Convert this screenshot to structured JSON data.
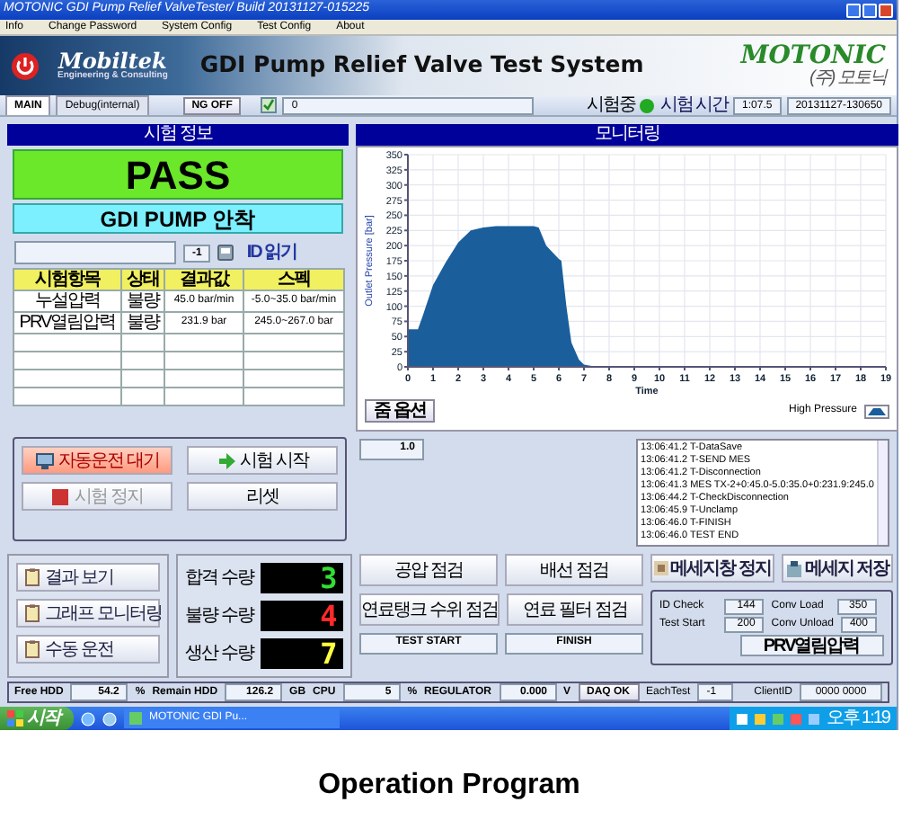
{
  "window": {
    "title": "MOTONIC GDI Pump Relief ValveTester/ Build 20131127-015225"
  },
  "menu": [
    "Info",
    "Change Password",
    "System Config",
    "Test Config",
    "About"
  ],
  "header": {
    "logo": "Mobiltek",
    "logo_subtitle": "Engineering & Consulting",
    "title": "GDI Pump Relief Valve Test System",
    "brand": "MOTONIC",
    "brand_subtitle": "(주) 모토닉"
  },
  "toolbar": {
    "tabs": [
      {
        "label": "MAIN",
        "selected": true
      },
      {
        "label": "Debug(internal)",
        "selected": false
      }
    ],
    "ng_button": "NG OFF",
    "checked": true,
    "counter": "0",
    "testing_label": "시험중",
    "testing_on": true,
    "time_label": "시험 시간",
    "time": "1:07.5",
    "timestamp": "20131127-130650"
  },
  "info_panel": {
    "heading": "시험 정보",
    "result": "PASS",
    "product": "GDI PUMP 안착",
    "id_count": "-1",
    "id_button": "ID 읽기",
    "table": {
      "columns": [
        "시험항목",
        "상태",
        "결과값",
        "스펙"
      ],
      "rows": [
        [
          "누설압력",
          "불량",
          "45.0 bar/min",
          "-5.0~35.0 bar/min"
        ],
        [
          "PRV열림압력",
          "불량",
          "231.9 bar",
          "245.0~267.0 bar"
        ]
      ]
    }
  },
  "monitor": {
    "heading": "모니터링",
    "zoom_button": "줌 옵션",
    "chart_data": {
      "type": "area",
      "xlabel": "Time",
      "ylabel": "Outlet Pressure [bar]",
      "x": [
        0,
        0.4,
        0.6,
        1,
        1.5,
        2,
        2.5,
        3,
        3.5,
        4,
        5,
        5.2,
        5.5,
        6,
        6.1,
        6.3,
        6.5,
        6.8,
        7,
        7.5,
        19
      ],
      "series": [
        {
          "name": "High Pressure",
          "color": "#1a5e9c",
          "values": [
            62,
            62,
            85,
            135,
            172,
            205,
            225,
            230,
            232,
            232,
            232,
            230,
            200,
            178,
            175,
            100,
            40,
            12,
            4,
            0,
            0
          ]
        }
      ],
      "xlim": [
        0,
        19
      ],
      "ylim": [
        0,
        350
      ],
      "grid": true,
      "xticks": [
        0,
        1,
        2,
        3,
        4,
        5,
        6,
        7,
        8,
        9,
        10,
        11,
        12,
        13,
        14,
        15,
        16,
        17,
        18,
        19
      ],
      "yticks": [
        0,
        25,
        50,
        75,
        100,
        125,
        150,
        175,
        200,
        225,
        250,
        275,
        300,
        325,
        350
      ]
    }
  },
  "scale_value": "1.0",
  "control_buttons": [
    {
      "kind": "auto",
      "label": "자동운전 대기",
      "active": true,
      "disabled": false
    },
    {
      "kind": "start",
      "label": "시험 시작",
      "active": false,
      "disabled": false
    },
    {
      "kind": "stop",
      "label": "시험 정지",
      "active": false,
      "disabled": true
    },
    {
      "kind": "reset",
      "label": "리셋",
      "active": false,
      "disabled": false
    }
  ],
  "side_buttons": [
    "결과 보기",
    "그래프 모니터링",
    "수동 운전"
  ],
  "counts": [
    {
      "kind": "pass",
      "label": "합격 수량",
      "value": "3"
    },
    {
      "kind": "fail",
      "label": "불량 수량",
      "value": "4"
    },
    {
      "kind": "total",
      "label": "생산 수량",
      "value": "7"
    }
  ],
  "check_buttons": [
    "공압 점검",
    "배선 점검",
    "연료탱크 수위 점검",
    "연료 필터 점검"
  ],
  "step_fields": [
    "TEST START",
    "FINISH"
  ],
  "log": [
    "13:06:41.2 T-DataSave",
    "13:06:41.2 T-SEND MES",
    "13:06:41.2 T-Disconnection",
    "13:06:41.3 MES TX-2+0:45.0-5.0:35.0+0:231.9:245.0",
    "13:06:44.2 T-CheckDisconnection",
    "13:06:45.9 T-Unclamp",
    "13:06:46.0 T-FINISH",
    "13:06:46.0 TEST END"
  ],
  "message_buttons": [
    "메세지창 정지",
    "메세지 저장"
  ],
  "sensors": [
    {
      "label": "ID Check",
      "value": "144"
    },
    {
      "label": "Conv Load",
      "value": "350"
    },
    {
      "label": "Test Start",
      "value": "200"
    },
    {
      "label": "Conv Unload",
      "value": "400"
    }
  ],
  "sensor_status": "PRV열림압력",
  "status_bar": [
    {
      "label": "Free HDD",
      "value": "54.2",
      "unit": "%"
    },
    {
      "label": "Remain HDD",
      "value": "126.2",
      "unit": "GB"
    },
    {
      "label": "CPU",
      "value": "5",
      "unit": "%"
    },
    {
      "label": "REGULATOR",
      "value": "0.000",
      "unit": "V"
    }
  ],
  "daq": "DAQ OK",
  "each_test_label": "EachTest",
  "each_test": "-1",
  "client_label": "ClientID",
  "client_id": "0000 0000",
  "taskbar": {
    "start": "시작",
    "window": "MOTONIC GDI Pu...",
    "clock": "오후 1:19"
  },
  "caption": "Operation Program"
}
